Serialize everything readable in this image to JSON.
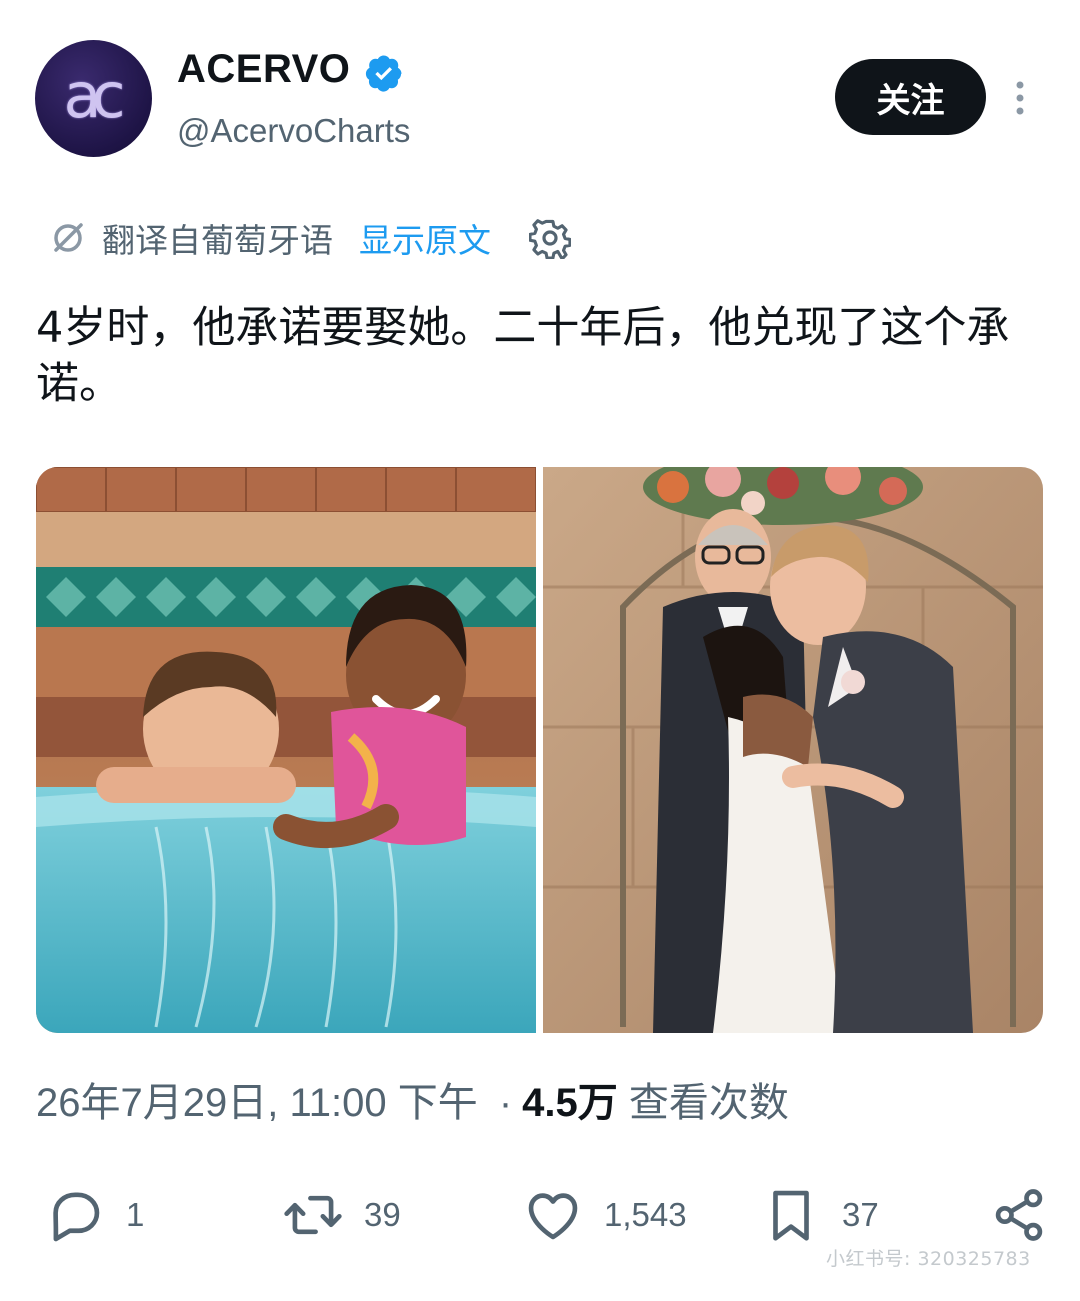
{
  "author": {
    "avatar_text": "ac",
    "name": "ACERVO",
    "handle": "@AcervoCharts",
    "verified": true
  },
  "follow_label": "关注",
  "translation": {
    "label": "翻译自葡萄牙语",
    "show_original": "显示原文"
  },
  "tweet_text": "4岁时，他承诺要娶她。二十年后，他兑现了这个承诺。",
  "meta": {
    "timestamp": "26年7月29日, 11:00 下午",
    "separator": "·",
    "views_count": "4.5万",
    "views_label": "查看次数"
  },
  "actions": {
    "replies": "1",
    "reposts": "39",
    "likes": "1,543",
    "bookmarks": "37"
  },
  "watermark": "小红书号: 320325783",
  "colors": {
    "accent": "#1d9bf0",
    "muted": "#536471",
    "text": "#0f1419"
  }
}
